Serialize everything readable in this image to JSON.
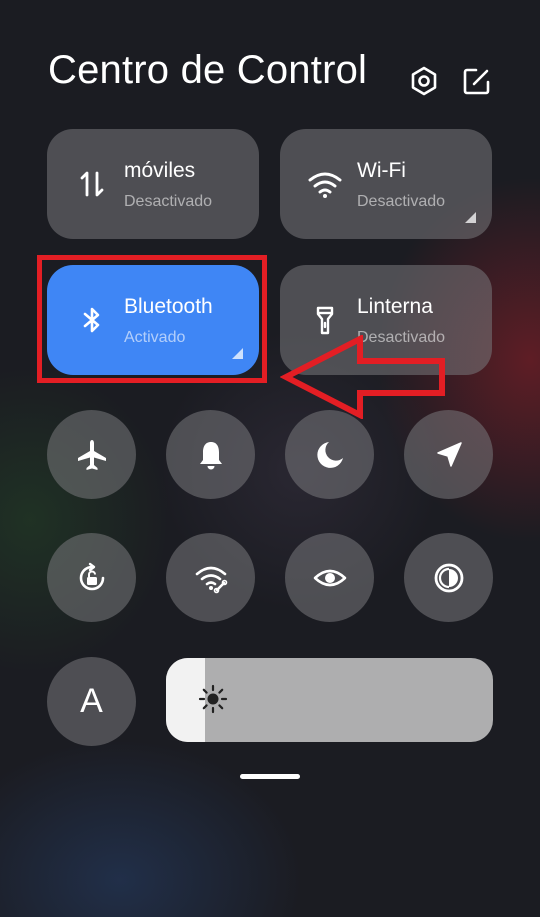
{
  "header": {
    "title": "Centro de Control",
    "settings_icon": "gear-hexagon-icon",
    "edit_icon": "edit-icon"
  },
  "tiles": [
    {
      "id": "mobile-data",
      "name": "móviles",
      "status": "Desactivado",
      "icon": "mobile-data-arrows-icon",
      "active": false
    },
    {
      "id": "wifi",
      "name": "Wi-Fi",
      "status": "Desactivado",
      "icon": "wifi-icon",
      "active": false
    },
    {
      "id": "bluetooth",
      "name": "Bluetooth",
      "status": "Activado",
      "icon": "bluetooth-icon",
      "active": true
    },
    {
      "id": "flashlight",
      "name": "Linterna",
      "status": "Desactivado",
      "icon": "flashlight-icon",
      "active": false
    }
  ],
  "toggles_row1": [
    "airplane-icon",
    "bell-icon",
    "moon-icon",
    "location-arrow-icon"
  ],
  "toggles_row2": [
    "rotation-lock-icon",
    "wifi-share-icon",
    "eye-icon",
    "contrast-icon"
  ],
  "font_button": {
    "label": "A"
  },
  "brightness": {
    "level": 0.12,
    "icon": "sun-icon"
  },
  "colors": {
    "active_tile": "#3f86f5",
    "highlight": "#e31e24"
  }
}
